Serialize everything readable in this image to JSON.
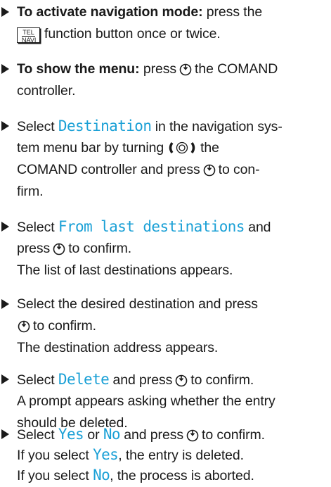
{
  "steps": [
    {
      "lines": [
        {
          "bold": "To activate navigation mode:",
          "text": " press the"
        },
        {
          "button_top": "TEL",
          "button_bottom": "NAVI",
          "text": "function button once or twice."
        }
      ]
    },
    {
      "lines": [
        {
          "bold": "To show the menu:",
          "text": " press",
          "icon": "press-controller-icon",
          "text2": "the COMAND"
        },
        {
          "text": "controller."
        }
      ]
    },
    {
      "lines": [
        {
          "text": "Select ",
          "display": "Destination",
          "text2": " in the navigation sys-"
        },
        {
          "text": "tem menu bar by turning",
          "icon": "turn-controller-icon",
          "text2": "the"
        },
        {
          "text": "COMAND controller and press",
          "icon": "press-controller-icon",
          "text2": "to con-"
        },
        {
          "text": "firm."
        }
      ]
    },
    {
      "lines": [
        {
          "text": "Select ",
          "display": "From last destinations",
          "text2": " and"
        },
        {
          "text": "press",
          "icon": "press-controller-icon",
          "text2": "to confirm."
        },
        {
          "text": "The list of last destinations appears."
        }
      ]
    },
    {
      "lines": [
        {
          "text": "Select the desired destination and press"
        },
        {
          "icon": "press-controller-icon",
          "text": "to confirm."
        },
        {
          "text": "The destination address appears."
        }
      ]
    },
    {
      "lines": [
        {
          "text": "Select ",
          "display": "Delete",
          "text2": " and press",
          "icon": "press-controller-icon",
          "text3": "to confirm."
        },
        {
          "text": "A prompt appears asking whether the entry"
        },
        {
          "text": "should be deleted."
        }
      ]
    },
    {
      "lines": [
        {
          "text": "Select ",
          "display": "Yes",
          "text2": " or ",
          "display2": "No",
          "text3": " and press",
          "icon": "press-controller-icon",
          "text4": "to confirm."
        },
        {
          "text": "If you select ",
          "display": "Yes",
          "text2": ", the entry is deleted."
        },
        {
          "text": "If you select ",
          "display": "No",
          "text2": ", the process is aborted."
        }
      ]
    }
  ]
}
